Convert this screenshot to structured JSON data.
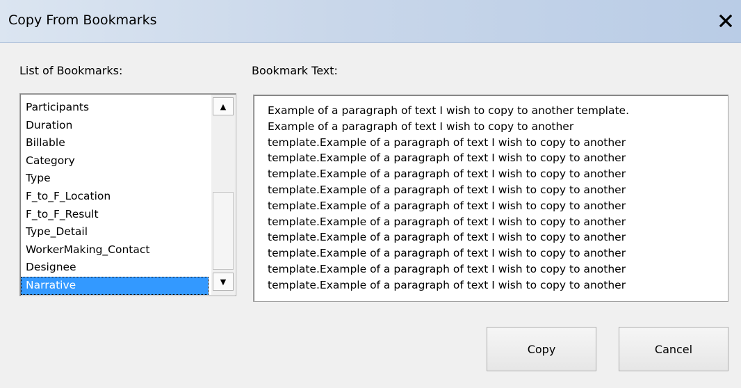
{
  "window": {
    "title": "Copy From Bookmarks",
    "close_label": "✕"
  },
  "bookmarks": {
    "label": "List of Bookmarks:",
    "items": [
      "Participants",
      "Duration",
      "Billable",
      "Category",
      "Type",
      "F_to_F_Location",
      "F_to_F_Result",
      "Type_Detail",
      "WorkerMaking_Contact",
      "Designee",
      "Narrative"
    ],
    "selected": "Narrative",
    "scroll_up_icon": "▲",
    "scroll_down_icon": "▼"
  },
  "bookmark_text": {
    "label": "Bookmark Text:",
    "lines": [
      "Example of a paragraph of text I wish to copy to another template.",
      "Example of a paragraph of text I wish to copy to another",
      "template.Example of a paragraph of text I wish to copy to another",
      "template.Example of a paragraph of text I wish to copy to another",
      "template.Example of a paragraph of text I wish to copy to another",
      "template.Example of a paragraph of text I wish to copy to another",
      "template.Example of a paragraph of text I wish to copy to another",
      "template.Example of a paragraph of text I wish to copy to another",
      "template.Example of a paragraph of text I wish to copy to another",
      "template.Example of a paragraph of text I wish to copy to another",
      "template.Example of a paragraph of text I wish to copy to another",
      "template.Example of a paragraph of text I wish to copy to another"
    ]
  },
  "buttons": {
    "copy_label": "Copy",
    "cancel_label": "Cancel"
  }
}
